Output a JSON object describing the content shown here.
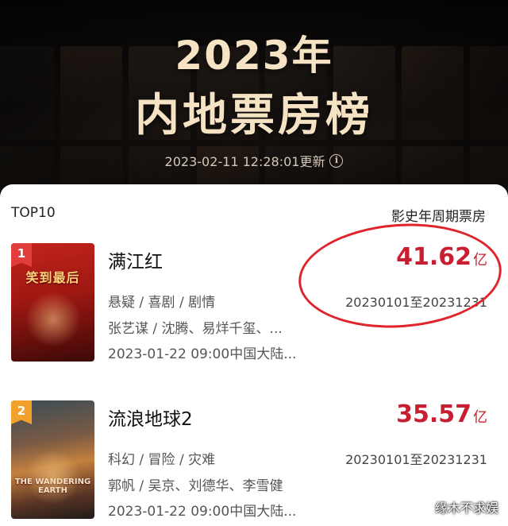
{
  "header": {
    "title_line1": "2023年",
    "title_line2": "内地票房榜",
    "updated_text": "2023-02-11 12:28:01更新",
    "info_icon": "info-icon"
  },
  "list": {
    "left_label": "TOP10",
    "right_label": "影史年周期票房",
    "items": [
      {
        "rank": "1",
        "title": "满江红",
        "poster_text": "笑到最后",
        "genres": "悬疑 / 喜剧 / 剧情",
        "cast": "张艺谋 / 沈腾、易烊千玺、...",
        "release": "2023-01-22 09:00中国大陆...",
        "gross_value": "41.62",
        "gross_unit": "亿",
        "period": "20230101至20231231",
        "rank_color": "#e23d3d"
      },
      {
        "rank": "2",
        "title": "流浪地球2",
        "poster_text": "THE WANDERING EARTH",
        "genres": "科幻 / 冒险 / 灾难",
        "cast": "郭帆 / 吴京、刘德华、李雪健",
        "release": "2023-01-22 09:00中国大陆...",
        "gross_value": "35.57",
        "gross_unit": "亿",
        "period": "20230101至20231231",
        "rank_color": "#f2a02c"
      }
    ]
  },
  "accent_color": "#c81e32",
  "annotation_color": "#e0242b",
  "watermark": "缘木不求娱"
}
